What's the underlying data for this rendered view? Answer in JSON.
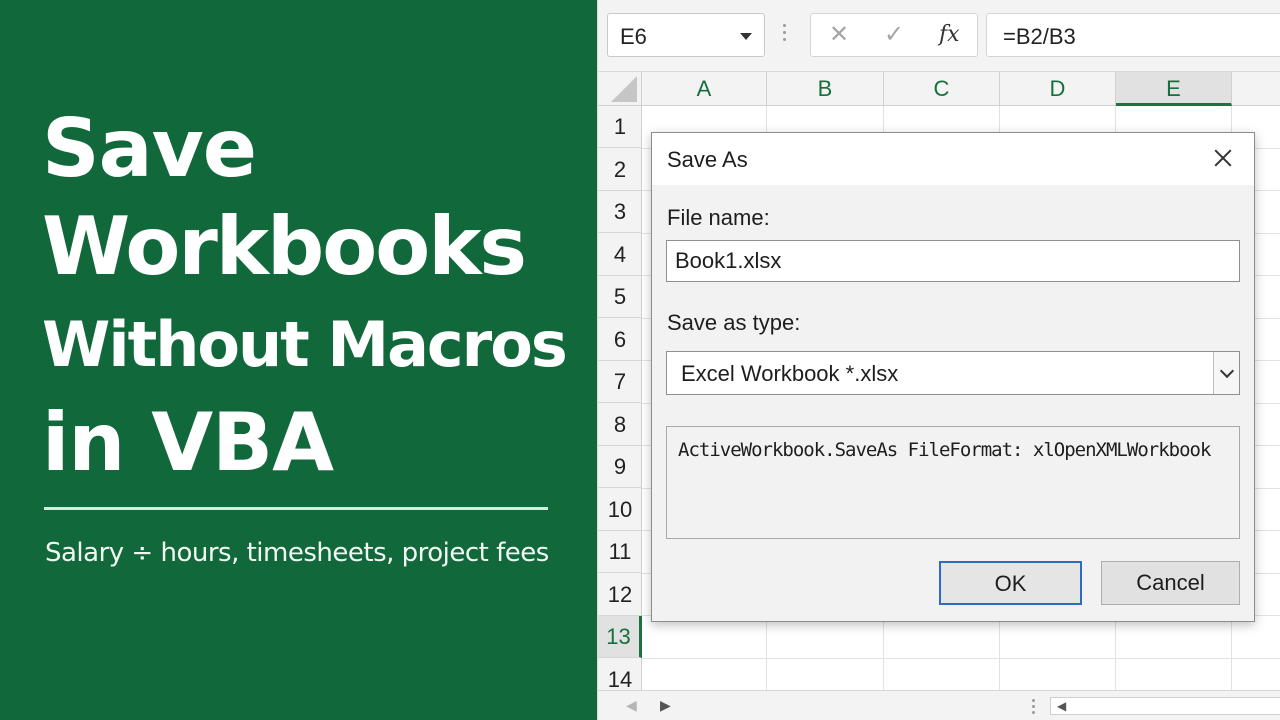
{
  "promo": {
    "title_lines": [
      "Save",
      "Workbooks",
      "Without Macros",
      "in VBA"
    ],
    "subtitle": "Salary ÷ hours, timesheets, project fees",
    "background_color": "#11693b"
  },
  "formula_bar": {
    "name_box": "E6",
    "cancel_icon": "✕",
    "enter_icon": "✓",
    "fx_label": "fx",
    "formula": "=B2/B3"
  },
  "columns": [
    "A",
    "B",
    "C",
    "D",
    "E"
  ],
  "selected_column": "E",
  "rows": [
    "1",
    "2",
    "3",
    "4",
    "5",
    "6",
    "7",
    "8",
    "9",
    "10",
    "11",
    "12",
    "13",
    "14"
  ],
  "selected_row": "13",
  "dialog": {
    "title": "Save As",
    "file_name_label": "File name:",
    "file_name_value": "Book1.xlsx",
    "save_as_type_label": "Save as type:",
    "save_as_type_value": "Excel Workbook *.xlsx",
    "code": "ActiveWorkbook.SaveAs FileFormat: xlOpenXMLWorkbook",
    "ok_label": "OK",
    "cancel_label": "Cancel"
  },
  "colors": {
    "accent_green": "#1a7340",
    "ok_border": "#2f6bbf"
  }
}
